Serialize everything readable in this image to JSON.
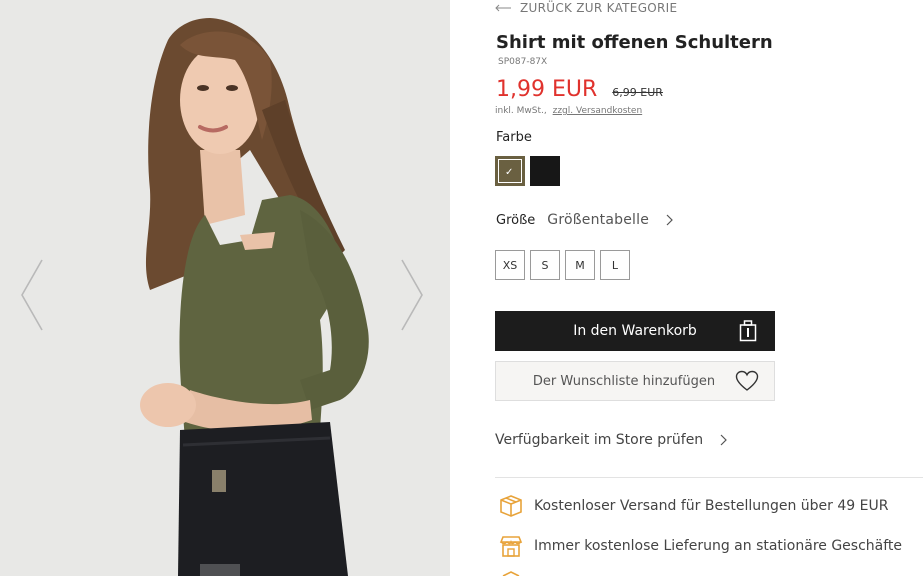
{
  "gallery": {
    "prev_icon": "chevron-left-icon",
    "next_icon": "chevron-right-icon"
  },
  "nav": {
    "back_label": "ZURÜCK ZUR KATEGORIE",
    "back_icon": "arrow-left-icon"
  },
  "product": {
    "title": "Shirt mit offenen Schultern",
    "sku": "SP087-87X",
    "price_current": "1,99 EUR",
    "price_old": "6,99 EUR",
    "tax_text": "inkl. MwSt.,",
    "shipping_link": "zzgl. Versandkosten"
  },
  "colors": {
    "label": "Farbe",
    "options": [
      {
        "name": "olive",
        "hex": "#6a6041",
        "selected": true
      },
      {
        "name": "black",
        "hex": "#171717",
        "selected": false
      }
    ]
  },
  "sizes": {
    "label": "Größe",
    "table_link": "Größentabelle",
    "options": [
      "XS",
      "S",
      "M",
      "L"
    ]
  },
  "actions": {
    "add_to_cart": "In den Warenkorb",
    "add_to_cart_icon": "shopping-bag-icon",
    "wishlist": "Der Wunschliste hinzufügen",
    "wishlist_icon": "heart-icon",
    "store_availability": "Verfügbarkeit im Store prüfen"
  },
  "perks": [
    {
      "icon": "shipping-box-icon",
      "text": "Kostenloser Versand für Bestellungen über 49 EUR"
    },
    {
      "icon": "store-icon",
      "text": "Immer kostenlose Lieferung an stationäre Geschäfte"
    }
  ],
  "colors_theme": {
    "price_red": "#e0322d",
    "perk_icon_orange": "#e8a33a",
    "button_dark": "#1c1c1c"
  }
}
